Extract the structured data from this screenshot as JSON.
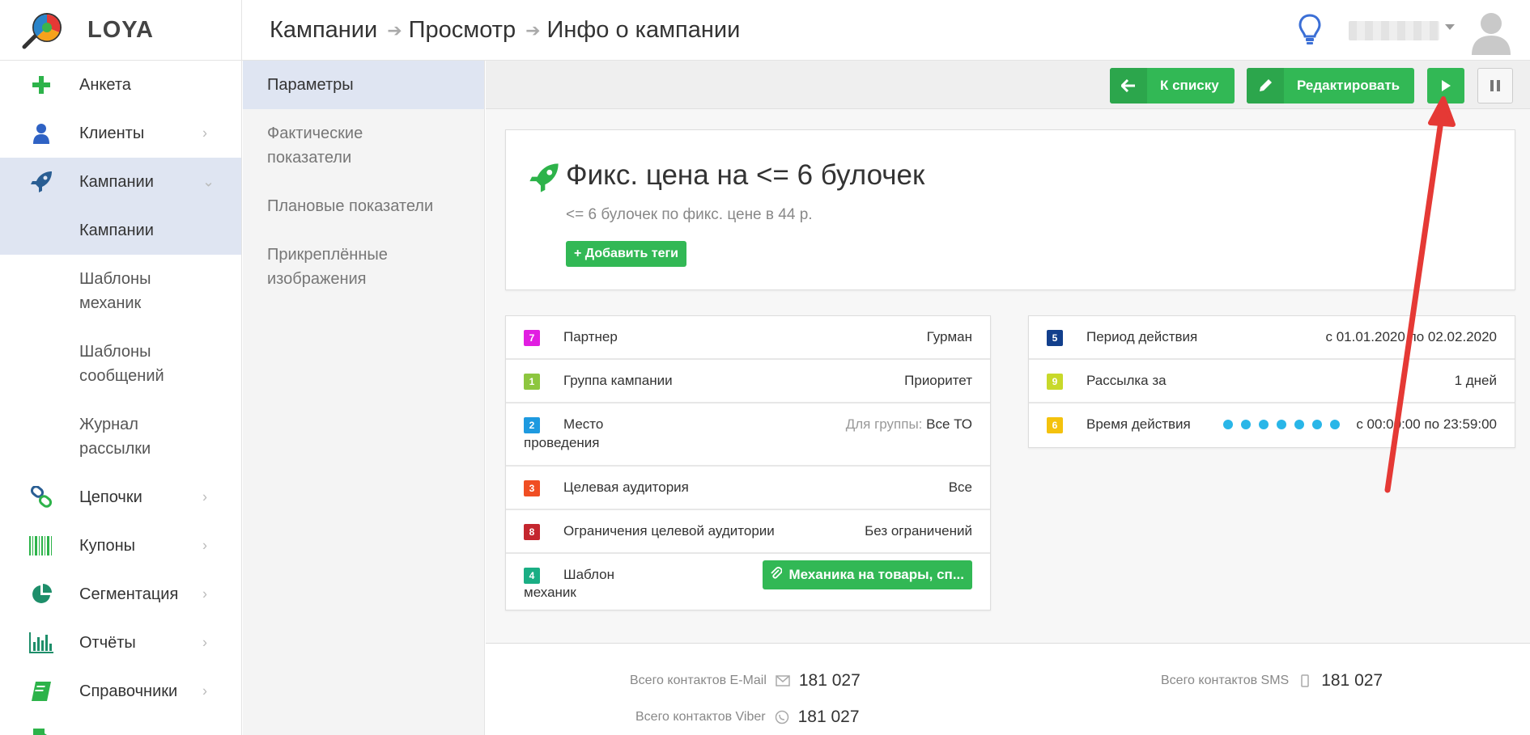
{
  "brand": {
    "name": "LOYA"
  },
  "breadcrumb": [
    "Кампании",
    "Просмотр",
    "Инфо о кампании"
  ],
  "sidebar": {
    "items": [
      {
        "label": "Анкета",
        "icon": "plus-icon"
      },
      {
        "label": "Клиенты",
        "icon": "user-icon"
      },
      {
        "label": "Кампании",
        "icon": "rocket-icon"
      },
      {
        "label": "Цепочки",
        "icon": "chain-icon"
      },
      {
        "label": "Купоны",
        "icon": "barcode-icon"
      },
      {
        "label": "Сегментация",
        "icon": "pie-icon"
      },
      {
        "label": "Отчёты",
        "icon": "bar-chart-icon"
      },
      {
        "label": "Справочники",
        "icon": "book-icon"
      }
    ],
    "sub": [
      "Кампании",
      "Шаблоны механик",
      "Шаблоны сообщений",
      "Журнал рассылки"
    ]
  },
  "subnav": [
    "Параметры",
    "Фактические показатели",
    "Плановые показатели",
    "Прикреплённые изображения"
  ],
  "toolbar": {
    "list_label": "К списку",
    "edit_label": "Редактировать"
  },
  "campaign": {
    "title": "Фикс. цена на <= 6 булочек",
    "description": "<= 6 булочек по фикс. цене в 44 р.",
    "add_tags": "+ Добавить теги"
  },
  "params_left": [
    {
      "num": "7",
      "color": "#e11ee1",
      "label": "Партнер",
      "value": "Гурман"
    },
    {
      "num": "1",
      "color": "#8dc63f",
      "label": "Группа кампании",
      "value": "Приоритет"
    },
    {
      "num": "2",
      "color": "#1e9ae0",
      "label": "Место",
      "label2": "проведения",
      "prefix": "Для группы:",
      "value": "Все ТО"
    },
    {
      "num": "3",
      "color": "#f04e23",
      "label": "Целевая аудитория",
      "value": "Все"
    },
    {
      "num": "8",
      "color": "#c4262e",
      "label": "Ограничения целевой аудитории",
      "value": "Без ограничений"
    },
    {
      "num": "4",
      "color": "#1aae84",
      "label": "Шаблон",
      "label2": "механик",
      "value": "Механика на товары, сп..."
    }
  ],
  "params_right": [
    {
      "num": "5",
      "color": "#123f8c",
      "label": "Период действия",
      "value": "с 01.01.2020 по 02.02.2020"
    },
    {
      "num": "9",
      "color": "#c8d92a",
      "label": "Рассылка за",
      "value": "1 дней"
    },
    {
      "num": "6",
      "color": "#f4c20d",
      "label": "Время действия",
      "value": "с 00:00:00 по 23:59:00",
      "dots": 7
    }
  ],
  "stats": {
    "email_label": "Всего контактов E-Mail",
    "email_value": "181 027",
    "sms_label": "Всего контактов SMS",
    "sms_value": "181 027",
    "viber_label": "Всего контактов Viber",
    "viber_value": "181 027"
  },
  "colors": {
    "accent_green": "#32b855",
    "active_bg": "#dfe5f2",
    "annotation_arrow": "#e53935"
  }
}
